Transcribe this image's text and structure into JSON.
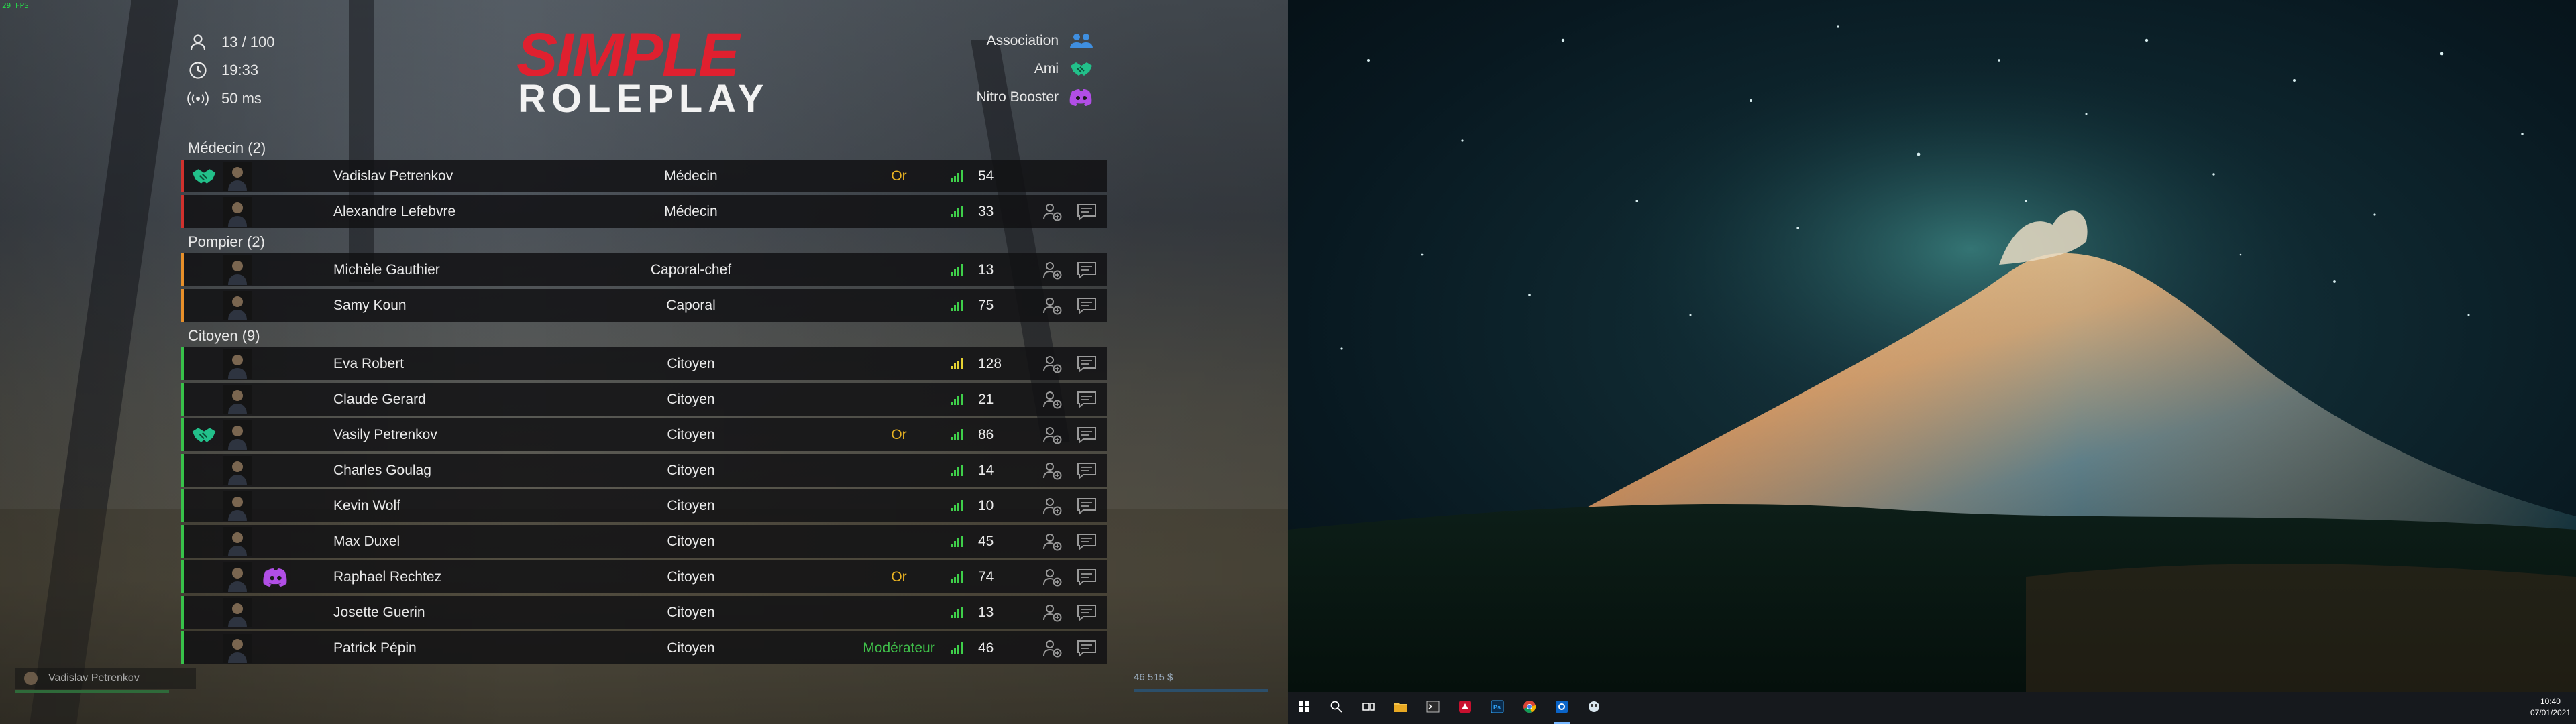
{
  "fps": "29 FPS",
  "stats": [
    {
      "icon": "person-icon",
      "value": "13 / 100"
    },
    {
      "icon": "clock-icon",
      "value": "19:33"
    },
    {
      "icon": "signal-broadcast-icon",
      "value": "50 ms"
    }
  ],
  "logo": {
    "line1": "SIMPLE",
    "line2": "ROLEPLAY"
  },
  "legend": [
    {
      "label": "Association",
      "icon": "people-group-icon",
      "color": "#3f8fe0"
    },
    {
      "label": "Ami",
      "icon": "handshake-icon",
      "color": "#22c08a"
    },
    {
      "label": "Nitro Booster",
      "icon": "discord-icon",
      "color": "#b14ee6"
    }
  ],
  "groups": [
    {
      "title": "Médecin (2)",
      "color": "#d0312d",
      "players": [
        {
          "name": "Vadislav Petrenkov",
          "job": "Médecin",
          "rank": "Or",
          "rank_color": "#e8b222",
          "ping": "54",
          "friend": true,
          "nitro": false,
          "actions": false
        },
        {
          "name": "Alexandre Lefebvre",
          "job": "Médecin",
          "rank": "",
          "rank_color": "",
          "ping": "33",
          "friend": false,
          "nitro": false,
          "actions": true
        }
      ]
    },
    {
      "title": "Pompier (2)",
      "color": "#e8902a",
      "players": [
        {
          "name": "Michèle Gauthier",
          "job": "Caporal-chef",
          "rank": "",
          "rank_color": "",
          "ping": "13",
          "friend": false,
          "nitro": false,
          "actions": true
        },
        {
          "name": "Samy Koun",
          "job": "Caporal",
          "rank": "",
          "rank_color": "",
          "ping": "75",
          "friend": false,
          "nitro": false,
          "actions": true
        }
      ]
    },
    {
      "title": "Citoyen (9)",
      "color": "#38c24a",
      "players": [
        {
          "name": "Eva Robert",
          "job": "Citoyen",
          "rank": "",
          "rank_color": "",
          "ping": "128",
          "friend": false,
          "nitro": false,
          "actions": true,
          "ping_color": "#e6d232"
        },
        {
          "name": "Claude Gerard",
          "job": "Citoyen",
          "rank": "",
          "rank_color": "",
          "ping": "21",
          "friend": false,
          "nitro": false,
          "actions": true
        },
        {
          "name": "Vasily Petrenkov",
          "job": "Citoyen",
          "rank": "Or",
          "rank_color": "#e8b222",
          "ping": "86",
          "friend": true,
          "nitro": false,
          "actions": true
        },
        {
          "name": "Charles Goulag",
          "job": "Citoyen",
          "rank": "",
          "rank_color": "",
          "ping": "14",
          "friend": false,
          "nitro": false,
          "actions": true
        },
        {
          "name": "Kevin Wolf",
          "job": "Citoyen",
          "rank": "",
          "rank_color": "",
          "ping": "10",
          "friend": false,
          "nitro": false,
          "actions": true
        },
        {
          "name": "Max Duxel",
          "job": "Citoyen",
          "rank": "",
          "rank_color": "",
          "ping": "45",
          "friend": false,
          "nitro": false,
          "actions": true
        },
        {
          "name": "Raphael Rechtez",
          "job": "Citoyen",
          "rank": "Or",
          "rank_color": "#e8b222",
          "ping": "74",
          "friend": false,
          "nitro": true,
          "actions": true
        },
        {
          "name": "Josette Guerin",
          "job": "Citoyen",
          "rank": "",
          "rank_color": "",
          "ping": "13",
          "friend": false,
          "nitro": false,
          "actions": true
        },
        {
          "name": "Patrick Pépin",
          "job": "Citoyen",
          "rank": "Modérateur",
          "rank_color": "#3fbf4a",
          "ping": "46",
          "friend": false,
          "nitro": false,
          "actions": true
        }
      ]
    }
  ],
  "hud": {
    "player_label": "Vadislav Petrenkov",
    "money": "46 515 $"
  },
  "taskbar": {
    "items": [
      {
        "icon": "windows-start-icon"
      },
      {
        "icon": "search-icon"
      },
      {
        "icon": "task-view-icon"
      },
      {
        "icon": "file-explorer-icon"
      },
      {
        "icon": "terminal-icon"
      },
      {
        "icon": "game-launcher-icon"
      },
      {
        "icon": "photoshop-icon"
      },
      {
        "icon": "chrome-icon"
      },
      {
        "icon": "outlook-icon",
        "active": true
      },
      {
        "icon": "app-icon"
      }
    ],
    "time": "10:40",
    "date": "07/01/2021"
  }
}
